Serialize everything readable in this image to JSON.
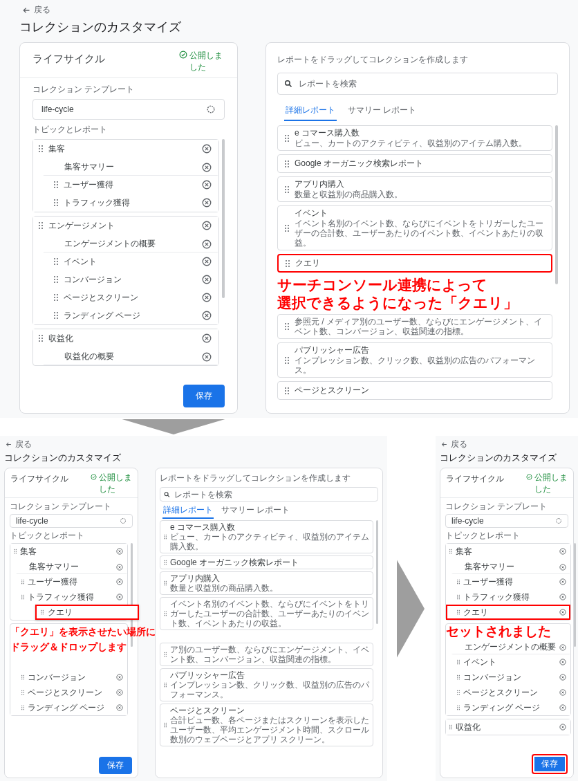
{
  "main_screen": {
    "back_link": "戻る",
    "title": "コレクションのカスタマイズ",
    "collection_panel": {
      "name": "ライフサイクル",
      "status": "公開しました",
      "template_label": "コレクション テンプレート",
      "template_value": "life-cycle",
      "topics_label": "トピックとレポート",
      "groups": [
        {
          "rows": [
            {
              "kind": "topic",
              "label": "集客",
              "removable": true,
              "highlighted": false
            },
            {
              "kind": "summary",
              "label": "集客サマリー",
              "removable": true,
              "highlighted": false
            },
            {
              "kind": "report",
              "label": "ユーザー獲得",
              "removable": true,
              "highlighted": false
            },
            {
              "kind": "report",
              "label": "トラフィック獲得",
              "removable": true,
              "highlighted": false
            }
          ]
        },
        {
          "rows": [
            {
              "kind": "topic",
              "label": "エンゲージメント",
              "removable": true,
              "highlighted": false
            },
            {
              "kind": "summary",
              "label": "エンゲージメントの概要",
              "removable": true,
              "highlighted": false
            },
            {
              "kind": "report",
              "label": "イベント",
              "removable": true,
              "highlighted": false
            },
            {
              "kind": "report",
              "label": "コンバージョン",
              "removable": true,
              "highlighted": false
            },
            {
              "kind": "report",
              "label": "ページとスクリーン",
              "removable": true,
              "highlighted": false
            },
            {
              "kind": "report",
              "label": "ランディング ページ",
              "removable": true,
              "highlighted": false
            }
          ]
        },
        {
          "rows": [
            {
              "kind": "topic",
              "label": "収益化",
              "removable": true,
              "highlighted": false
            },
            {
              "kind": "summary",
              "label": "収益化の概要",
              "removable": true,
              "highlighted": false
            }
          ]
        }
      ],
      "save_button": {
        "label": "保存",
        "highlighted": false
      }
    },
    "report_panel": {
      "instruction": "レポートをドラッグしてコレクションを作成します",
      "search_placeholder": "レポートを検索",
      "tabs": [
        {
          "label": "詳細レポート",
          "selected": true
        },
        {
          "label": "サマリー レポート",
          "selected": false
        }
      ],
      "reports": [
        {
          "kind": "report",
          "title": "e コマース購入数",
          "description": "ビュー、カートのアクティビティ、収益別のアイテム購入数。",
          "highlighted": false
        },
        {
          "kind": "report",
          "title": "Google オーガニック検索レポート",
          "highlighted": false
        },
        {
          "kind": "report",
          "title": "アプリ内購入",
          "description": "数量と収益別の商品購入数。",
          "highlighted": false
        },
        {
          "kind": "report",
          "title": "イベント",
          "description": "イベント名別のイベント数、ならびにイベントをトリガーしたユーザーの合計数、ユーザーあたりのイベント数、イベントあたりの収益。",
          "highlighted": false
        },
        {
          "kind": "report",
          "title": "クエリ",
          "highlighted": true
        },
        {
          "kind": "covered"
        },
        {
          "kind": "report",
          "description": "参照元 / メディア別のユーザー数、ならびにエンゲージメント、イベント数、コンバージョン、収益関連の指標。",
          "highlighted": false
        },
        {
          "kind": "report",
          "title": "パブリッシャー広告",
          "description": "インプレッション数、クリック数、収益別の広告のパフォーマンス。",
          "highlighted": false
        },
        {
          "kind": "report",
          "title": "ページとスクリーン",
          "highlighted": false
        }
      ],
      "annotation": [
        "サーチコンソール連携によって",
        "選択できるようになった「クエリ」"
      ]
    }
  },
  "step_screens": [
    {
      "back_link": "戻る",
      "title": "コレクションのカスタマイズ",
      "collection_panel": {
        "name": "ライフサイクル",
        "status": "公開しました",
        "template_label": "コレクション テンプレート",
        "template_value": "life-cycle",
        "topics_label": "トピックとレポート",
        "groups": [
          {
            "rows": [
              {
                "kind": "topic",
                "label": "集客",
                "removable": true,
                "highlighted": false
              },
              {
                "kind": "summary",
                "label": "集客サマリー",
                "removable": true,
                "highlighted": false
              },
              {
                "kind": "report",
                "label": "ユーザー獲得",
                "removable": true,
                "highlighted": false
              },
              {
                "kind": "report",
                "label": "トラフィック獲得",
                "removable": true,
                "highlighted": false
              },
              {
                "kind": "slot"
              }
            ]
          },
          {
            "rows": [
              {
                "kind": "covered"
              },
              {
                "kind": "covered"
              },
              {
                "kind": "covered"
              },
              {
                "kind": "report",
                "label": "コンバージョン",
                "removable": true,
                "highlighted": false
              },
              {
                "kind": "report",
                "label": "ページとスクリーン",
                "removable": true,
                "highlighted": false
              },
              {
                "kind": "report",
                "label": "ランディング ページ",
                "removable": true,
                "highlighted": false
              }
            ]
          }
        ],
        "save_button": {
          "label": "保存",
          "highlighted": false
        },
        "annotation": [
          "「クエリ」を表示させたい場所に",
          "ドラッグ＆ドロップします"
        ]
      },
      "report_panel": {
        "instruction": "レポートをドラッグしてコレクションを作成します",
        "search_placeholder": "レポートを検索",
        "tabs": [
          {
            "label": "詳細レポート",
            "selected": true
          },
          {
            "label": "サマリー レポート",
            "selected": false
          }
        ],
        "reports": [
          {
            "kind": "report",
            "title": "e コマース購入数",
            "description": "ビュー、カートのアクティビティ、収益別のアイテム購入数。",
            "highlighted": false
          },
          {
            "kind": "report",
            "title": "Google オーガニック検索レポート",
            "highlighted": false
          },
          {
            "kind": "report",
            "title": "アプリ内購入",
            "description": "数量と収益別の商品購入数。",
            "highlighted": false
          },
          {
            "kind": "report",
            "description": "イベント名別のイベント数、ならびにイベントをトリガーしたユーザーの合計数、ユーザーあたりのイベント数、イベントあたりの収益。",
            "highlighted": false
          },
          {
            "kind": "covered"
          },
          {
            "kind": "report",
            "description": "ア別のユーザー数、ならびにエンゲージメント、イベント数、コンバージョン、収益関連の指標。",
            "highlighted": false
          },
          {
            "kind": "report",
            "title": "パブリッシャー広告",
            "description": "インプレッション数、クリック数、収益別の広告のパフォーマンス。",
            "highlighted": false
          },
          {
            "kind": "report",
            "title": "ページとスクリーン",
            "description": "合計ビュー数、各ページまたはスクリーンを表示したユーザー数、平均エンゲージメント時間、スクロール数別のウェブページとアプリ スクリーン。",
            "highlighted": false
          }
        ]
      },
      "drag_ghost": {
        "label": "クエリ",
        "highlighted": true
      }
    },
    {
      "back_link": "戻る",
      "title": "コレクションのカスタマイズ",
      "collection_panel": {
        "name": "ライフサイクル",
        "status": "公開しました",
        "template_label": "コレクション テンプレート",
        "template_value": "life-cycle",
        "topics_label": "トピックとレポート",
        "groups": [
          {
            "rows": [
              {
                "kind": "topic",
                "label": "集客",
                "removable": true,
                "highlighted": false
              },
              {
                "kind": "summary",
                "label": "集客サマリー",
                "removable": true,
                "highlighted": false
              },
              {
                "kind": "report",
                "label": "ユーザー獲得",
                "removable": true,
                "highlighted": false
              },
              {
                "kind": "report",
                "label": "トラフィック獲得",
                "removable": true,
                "highlighted": false
              },
              {
                "kind": "report",
                "label": "クエリ",
                "removable": true,
                "highlighted": true
              }
            ]
          },
          {
            "rows": [
              {
                "kind": "covered"
              },
              {
                "kind": "summary",
                "label": "エンゲージメントの概要",
                "removable": true,
                "highlighted": false
              },
              {
                "kind": "report",
                "label": "イベント",
                "removable": true,
                "highlighted": false
              },
              {
                "kind": "report",
                "label": "コンバージョン",
                "removable": true,
                "highlighted": false
              },
              {
                "kind": "report",
                "label": "ページとスクリーン",
                "removable": true,
                "highlighted": false
              },
              {
                "kind": "report",
                "label": "ランディング ページ",
                "removable": true,
                "highlighted": false
              }
            ]
          },
          {
            "rows": [
              {
                "kind": "topic",
                "label": "収益化",
                "removable": true,
                "highlighted": false
              }
            ]
          }
        ],
        "save_button": {
          "label": "保存",
          "highlighted": true
        },
        "annotation": [
          "セットされました"
        ]
      }
    }
  ]
}
